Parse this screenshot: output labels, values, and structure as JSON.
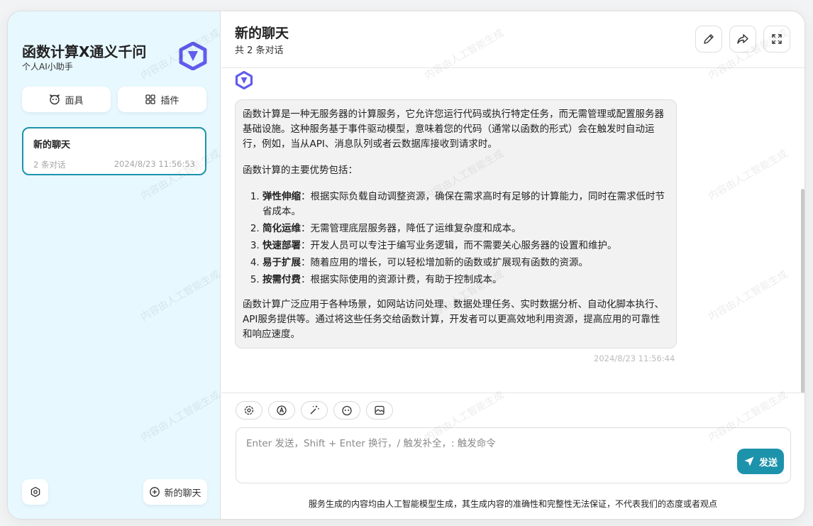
{
  "sidebar": {
    "title": "函数计算X通义千问",
    "subtitle": "个人AI小助手",
    "mask_label": "面具",
    "plugin_label": "插件",
    "chat_item": {
      "title": "新的聊天",
      "count": "2 条对话",
      "time": "2024/8/23 11:56:53"
    },
    "new_chat_label": "新的聊天"
  },
  "header": {
    "title": "新的聊天",
    "subtitle": "共 2 条对话"
  },
  "message": {
    "intro": "函数计算是一种无服务器的计算服务，它允许您运行代码或执行特定任务，而无需管理或配置服务器基础设施。这种服务基于事件驱动模型，意味着您的代码（通常以函数的形式）会在触发时自动运行，例如，当从API、消息队列或者云数据库接收到请求时。",
    "advantages_heading": "函数计算的主要优势包括：",
    "items": [
      {
        "term": "弹性伸缩",
        "desc": "：根据实际负载自动调整资源，确保在需求高时有足够的计算能力，同时在需求低时节省成本。"
      },
      {
        "term": "简化运维",
        "desc": "：无需管理底层服务器，降低了运维复杂度和成本。"
      },
      {
        "term": "快速部署",
        "desc": "：开发人员可以专注于编写业务逻辑，而不需要关心服务器的设置和维护。"
      },
      {
        "term": "易于扩展",
        "desc": "：随着应用的增长，可以轻松增加新的函数或扩展现有函数的资源。"
      },
      {
        "term": "按需付费",
        "desc": "：根据实际使用的资源计费，有助于控制成本。"
      }
    ],
    "conclusion": "函数计算广泛应用于各种场景，如网站访问处理、数据处理任务、实时数据分析、自动化脚本执行、API服务提供等。通过将这些任务交给函数计算，开发者可以更高效地利用资源，提高应用的可靠性和响应速度。",
    "time": "2024/8/23 11:56:44"
  },
  "input": {
    "placeholder": "Enter 发送，Shift + Enter 换行，/ 触发补全，: 触发命令",
    "send_label": "发送"
  },
  "footer_note": "服务生成的内容均由人工智能模型生成，其生成内容的准确性和完整性无法保证，不代表我们的态度或者观点",
  "watermark_text": "内容由人工智能生成",
  "colors": {
    "accent": "#1d93ab",
    "sidebar_bg": "#e7f8ff",
    "logo": "#615ced"
  }
}
